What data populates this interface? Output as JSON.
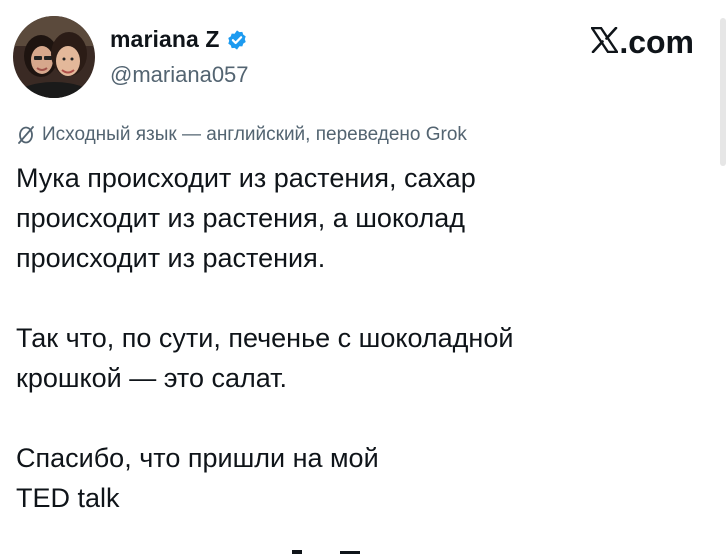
{
  "author": {
    "name": "mariana Z",
    "handle": "@mariana057",
    "verified": true,
    "avatar_icon": "profile-photo-icon"
  },
  "brand": {
    "logo_icon": "x-logo-icon",
    "logo_text": ".com"
  },
  "translation": {
    "icon": "translate-icon",
    "label": "Исходный язык — английский, переведено Grok"
  },
  "tweet": {
    "paragraphs": [
      [
        "Мука происходит из растения, сахар",
        "происходит из растения, а шоколад",
        "происходит из растения."
      ],
      [
        "Так что, по сути, печенье с шоколадной",
        "крошкой — это салат."
      ],
      [
        "Спасибо, что пришли на мой",
        "TED talk"
      ]
    ]
  },
  "colors": {
    "text_primary": "#0f1419",
    "text_secondary": "#536471",
    "verified_blue": "#1d9bf0",
    "background": "#ffffff"
  }
}
